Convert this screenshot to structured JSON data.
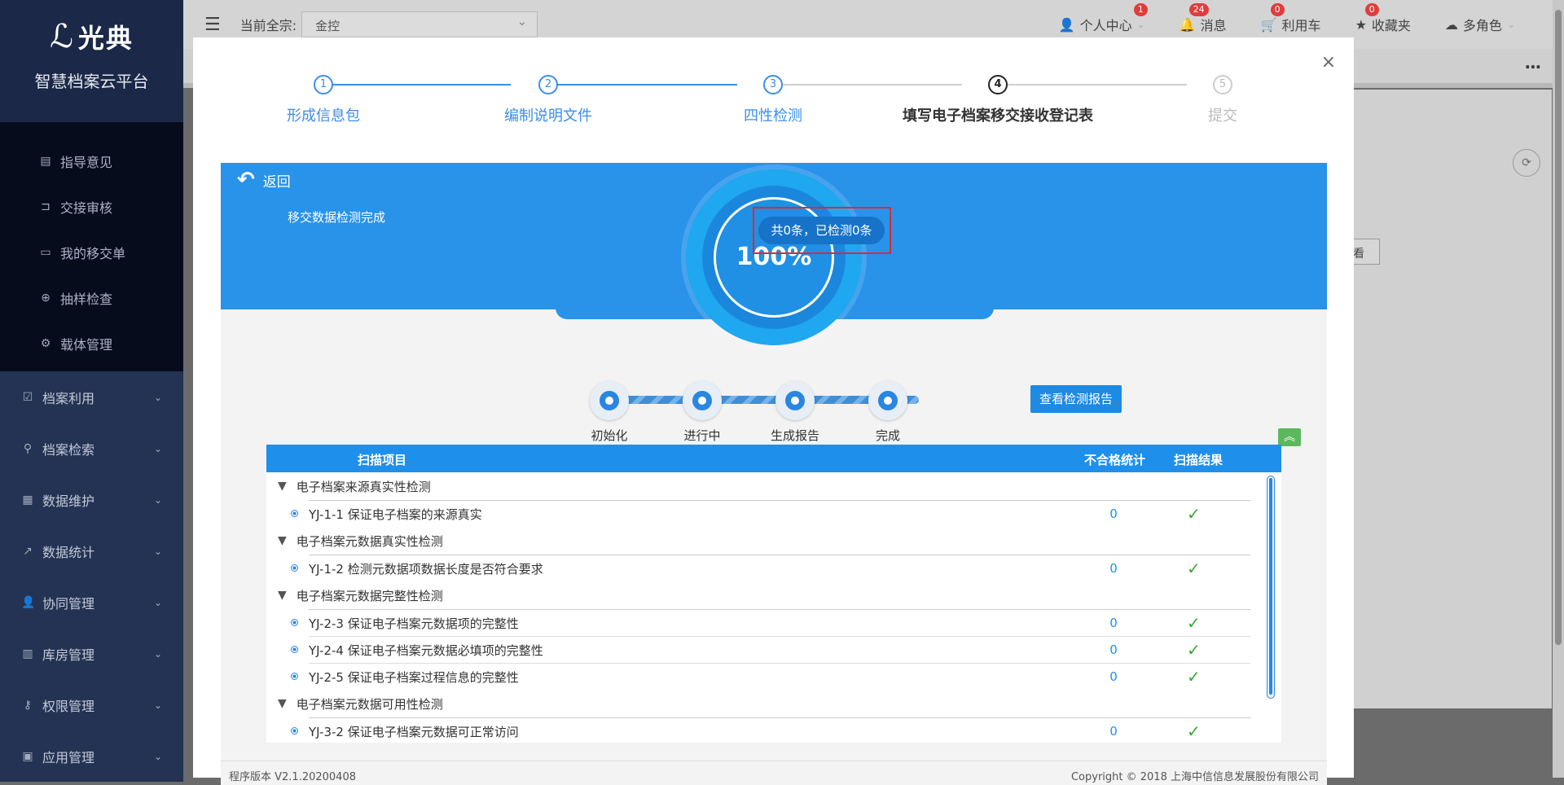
{
  "sidebar": {
    "logo_text": "光典",
    "platform_name": "智慧档案云平台",
    "sub_items": [
      {
        "label": "指导意见",
        "icon": "comment-icon"
      },
      {
        "label": "交接审核",
        "icon": "crop-icon"
      },
      {
        "label": "我的移交单",
        "icon": "form-icon"
      },
      {
        "label": "抽样检查",
        "icon": "target-icon"
      },
      {
        "label": "载体管理",
        "icon": "chip-icon"
      }
    ],
    "menu_items": [
      {
        "label": "档案利用",
        "icon": "checklist-icon"
      },
      {
        "label": "档案检索",
        "icon": "search-icon"
      },
      {
        "label": "数据维护",
        "icon": "database-icon"
      },
      {
        "label": "数据统计",
        "icon": "chart-icon"
      },
      {
        "label": "协同管理",
        "icon": "users-icon"
      },
      {
        "label": "库房管理",
        "icon": "building-icon"
      },
      {
        "label": "权限管理",
        "icon": "key-icon"
      },
      {
        "label": "应用管理",
        "icon": "app-icon"
      }
    ]
  },
  "topbar": {
    "current_label": "当前全宗:",
    "current_value": "金控",
    "personal_center": "个人中心",
    "personal_badge": "1",
    "messages": "消息",
    "messages_badge": "24",
    "cart": "利用车",
    "cart_badge": "0",
    "favorites": "收藏夹",
    "favorites_badge": "0",
    "roles": "多角色"
  },
  "background": {
    "view_btn": "看"
  },
  "modal": {
    "steps": [
      {
        "num": "1",
        "label": "形成信息包",
        "state": "done"
      },
      {
        "num": "2",
        "label": "编制说明文件",
        "state": "done"
      },
      {
        "num": "3",
        "label": "四性检测",
        "state": "done"
      },
      {
        "num": "4",
        "label": "填写电子档案移交接收登记表",
        "state": "active"
      },
      {
        "num": "5",
        "label": "提交",
        "state": "todo"
      }
    ],
    "back_label": "返回",
    "done_text": "移交数据检测完成",
    "progress_percent": "100%",
    "count_text": "共0条，已检测0条",
    "progress_nodes": [
      "初始化",
      "进行中",
      "生成报告",
      "完成"
    ],
    "report_button": "查看检测报告",
    "table": {
      "headers": {
        "item": "扫描项目",
        "fail_count": "不合格统计",
        "result": "扫描结果"
      },
      "groups": [
        {
          "title": "电子档案来源真实性检测",
          "rows": [
            {
              "name": "YJ-1-1 保证电子档案的来源真实",
              "count": "0"
            }
          ]
        },
        {
          "title": "电子档案元数据真实性检测",
          "rows": [
            {
              "name": "YJ-1-2 检测元数据项数据长度是否符合要求",
              "count": "0"
            }
          ]
        },
        {
          "title": "电子档案元数据完整性检测",
          "rows": [
            {
              "name": "YJ-2-3 保证电子档案元数据项的完整性",
              "count": "0"
            },
            {
              "name": "YJ-2-4 保证电子档案元数据必填项的完整性",
              "count": "0"
            },
            {
              "name": "YJ-2-5 保证电子档案过程信息的完整性",
              "count": "0"
            }
          ]
        },
        {
          "title": "电子档案元数据可用性检测",
          "rows": [
            {
              "name": "YJ-3-2 保证电子档案元数据可正常访问",
              "count": "0"
            }
          ]
        }
      ]
    },
    "footer_version": "程序版本 V2.1.20200408",
    "footer_copyright": "Copyright © 2018 上海中信信息发展股份有限公司"
  }
}
